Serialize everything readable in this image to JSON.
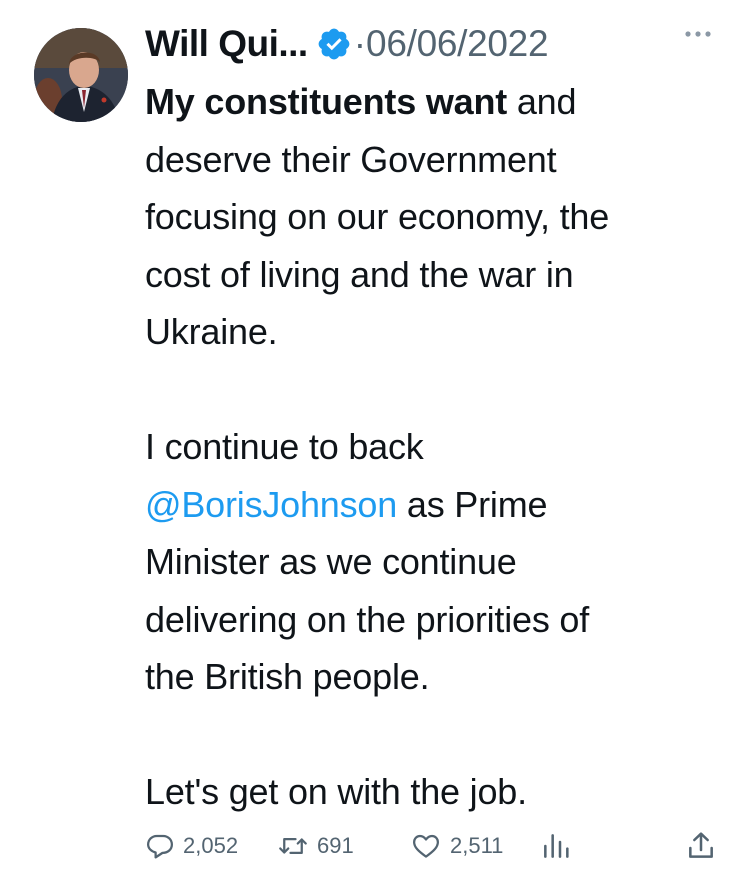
{
  "tweet": {
    "author": {
      "display_name": "Will Qui...",
      "verified": true,
      "avatar_icon": "profile-photo"
    },
    "separator": "·",
    "date": "06/06/2022",
    "more_icon": "more-horizontal-icon",
    "body": {
      "p1": {
        "bold_text": "My constituents want",
        "line1_rest": " and",
        "line2": "deserve their Government",
        "line3": "focusing on our economy, the",
        "line4": "cost of living and the war in",
        "line5": "Ukraine."
      },
      "p2": {
        "line1": "I continue to back",
        "mention": "@BorisJohnson",
        "line2_rest": " as Prime",
        "line3": "Minister as we continue",
        "line4": "delivering on the priorities of",
        "line5": "the British people."
      },
      "p3": {
        "line1": "Let's get on with the job."
      }
    },
    "actions": {
      "replies": {
        "icon": "reply-icon",
        "count": "2,052"
      },
      "retweets": {
        "icon": "retweet-icon",
        "count": "691"
      },
      "likes": {
        "icon": "heart-icon",
        "count": "2,511"
      },
      "views": {
        "icon": "analytics-icon"
      },
      "share": {
        "icon": "share-icon"
      }
    }
  },
  "colors": {
    "text": "#0f1419",
    "secondary": "#536471",
    "link": "#1d9bf0",
    "verified_badge": "#1d9bf0"
  }
}
